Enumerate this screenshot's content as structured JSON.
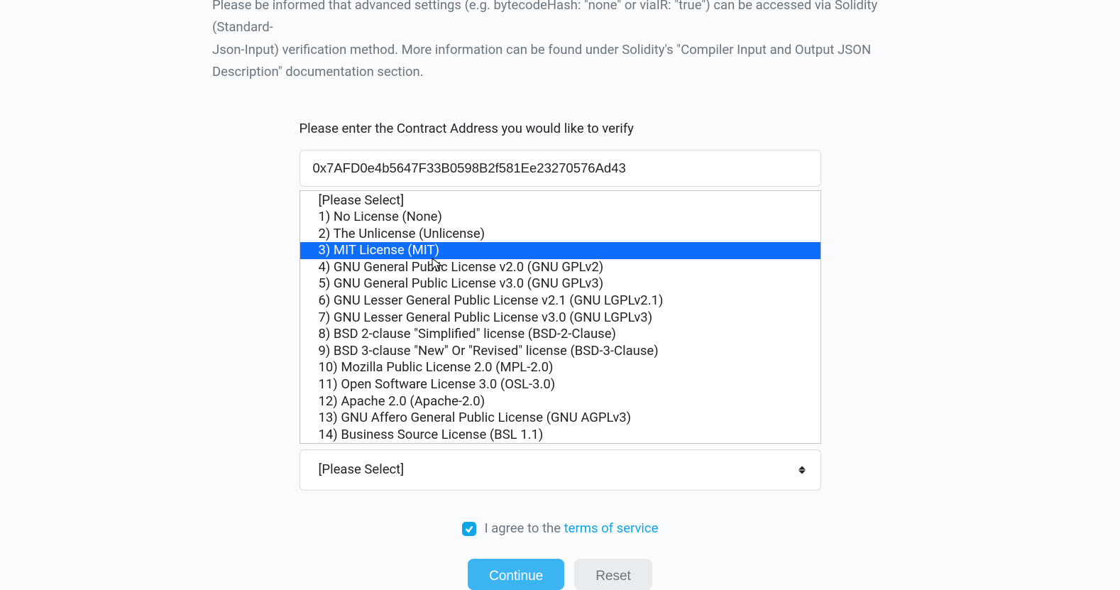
{
  "info": {
    "line1_partial": "Please be informed that advanced settings (e.g. bytecodeHash: \"none\" or viaIR: \"true\") can be accessed via Solidity (Standard-",
    "line2": "Json-Input) verification method. More information can be found under Solidity's \"Compiler Input and Output JSON Description\" documentation section."
  },
  "form": {
    "address_label": "Please enter the Contract Address you would like to verify",
    "address_value": "0x7AFD0e4b5647F33B0598B2f581Ee23270576Ad43",
    "license_options": [
      {
        "label": "[Please Select]",
        "highlighted": false
      },
      {
        "label": "1) No License (None)",
        "highlighted": false
      },
      {
        "label": "2) The Unlicense (Unlicense)",
        "highlighted": false
      },
      {
        "label": "3) MIT License (MIT)",
        "highlighted": true
      },
      {
        "label": "4) GNU General Public License v2.0 (GNU GPLv2)",
        "highlighted": false
      },
      {
        "label": "5) GNU General Public License v3.0 (GNU GPLv3)",
        "highlighted": false
      },
      {
        "label": "6) GNU Lesser General Public License v2.1 (GNU LGPLv2.1)",
        "highlighted": false
      },
      {
        "label": "7) GNU Lesser General Public License v3.0 (GNU LGPLv3)",
        "highlighted": false
      },
      {
        "label": "8) BSD 2-clause \"Simplified\" license (BSD-2-Clause)",
        "highlighted": false
      },
      {
        "label": "9) BSD 3-clause \"New\" Or \"Revised\" license (BSD-3-Clause)",
        "highlighted": false
      },
      {
        "label": "10) Mozilla Public License 2.0 (MPL-2.0)",
        "highlighted": false
      },
      {
        "label": "11) Open Software License 3.0 (OSL-3.0)",
        "highlighted": false
      },
      {
        "label": "12) Apache 2.0 (Apache-2.0)",
        "highlighted": false
      },
      {
        "label": "13) GNU Affero General Public License (GNU AGPLv3)",
        "highlighted": false
      },
      {
        "label": "14) Business Source License (BSL 1.1)",
        "highlighted": false
      }
    ],
    "select_placeholder": "[Please Select]",
    "agree_prefix": "I agree to the ",
    "tos_link": "terms of service",
    "continue_label": "Continue",
    "reset_label": "Reset"
  }
}
